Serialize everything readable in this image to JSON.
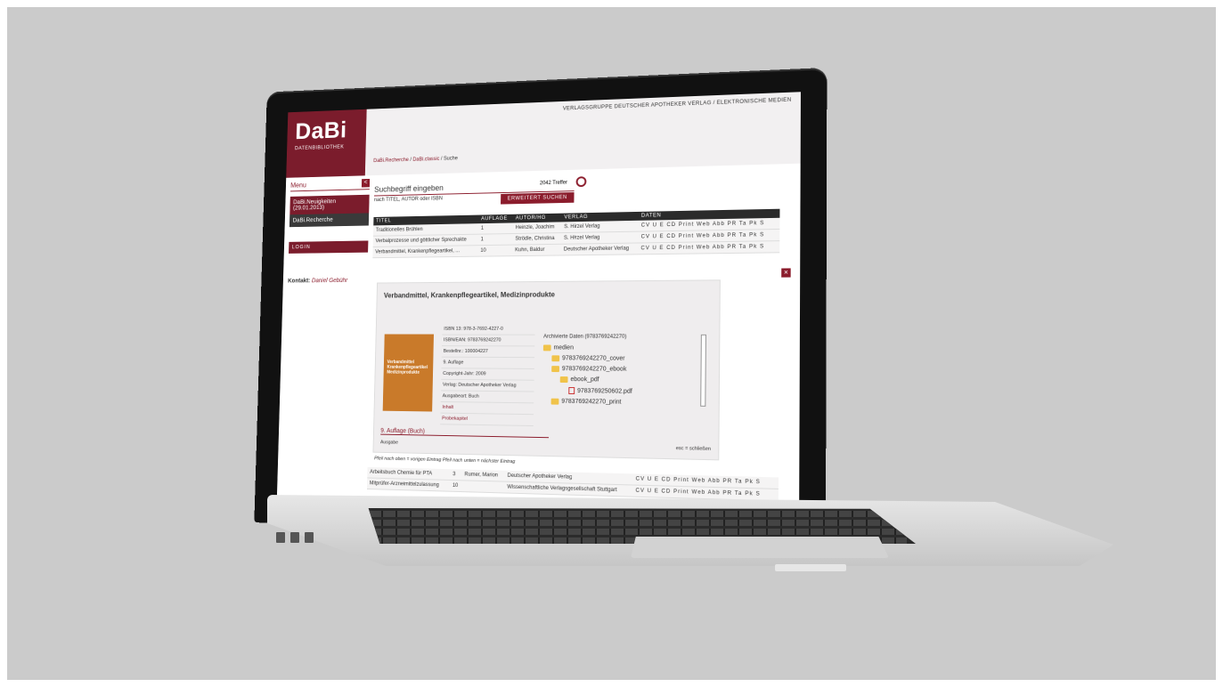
{
  "brand": {
    "logo": "DaBi",
    "subtitle": "DATENBIBLIOTHEK"
  },
  "header": {
    "publisher": "VERLAGSGRUPPE DEUTSCHER APOTHEKER VERLAG / ELEKTRONISCHE MEDIEN"
  },
  "breadcrumb": {
    "part1": "DaBi.Recherche",
    "part2": "DaBi.classic",
    "part3": "Suche"
  },
  "sidebar": {
    "menu_label": "Menu",
    "toggle": "<",
    "items": [
      {
        "label": "DaBi.Neuigkeiten (29.01.2013)"
      },
      {
        "label": "DaBi.Recherche"
      }
    ],
    "login": "LOGIN",
    "contact_prefix": "Kontakt:",
    "contact_name": "Daniel Gebühr"
  },
  "search": {
    "label": "Suchbegriff eingeben",
    "hint": "nach TITEL, AUTOR oder ISBN",
    "hits": "2042 Treffer",
    "advanced_button": "ERWEITERT SUCHEN"
  },
  "results": {
    "columns": [
      "TITEL",
      "AUFLAGE",
      "AUTOR/HG",
      "VERLAG",
      "DATEN"
    ],
    "rows": [
      {
        "title": "Traditionelles Brühlen",
        "edition": "1",
        "author": "Heinzle, Joachim",
        "publisher": "S. Hirzel Verlag",
        "data": "CV U E CD Print Web Abb PR Ta Pk S"
      },
      {
        "title": "Verbalprozesse und göttlicher Sprechakte",
        "edition": "1",
        "author": "Strödle, Christina",
        "publisher": "S. Hirzel Verlag",
        "data": "CV U E CD Print Web Abb PR Ta Pk S"
      },
      {
        "title": "Verbandmittel, Krankenpflegeartikel, ...",
        "edition": "10",
        "author": "Kuhn, Baldur",
        "publisher": "Deutscher Apotheker Verlag",
        "data": "CV U E CD Print Web Abb PR Ta Pk S"
      }
    ]
  },
  "detail": {
    "close": "×",
    "title": "Verbandmittel, Krankenpflegeartikel, Medizinprodukte",
    "cover_text": "Verbandmittel Krankenpflegeartikel Medizinprodukte",
    "meta": [
      "ISBN 13: 978-3-7692-4227-0",
      "ISBN/EAN: 9783769242270",
      "Bestellnr.: 100004227",
      "9. Auflage",
      "Copyright-Jahr: 2009",
      "Verlag: Deutscher Apotheker Verlag",
      "Ausgabeart: Buch"
    ],
    "pdf_links": [
      "Inhalt",
      "Probekapitel"
    ],
    "archive_header": "Archivierte Daten (9783769242270)",
    "folders": [
      {
        "label": "medien",
        "type": "folder"
      },
      {
        "label": "9783769242270_cover",
        "type": "folder"
      },
      {
        "label": "9783769242270_ebook",
        "type": "folder"
      },
      {
        "label": "ebook_pdf",
        "type": "folder"
      },
      {
        "label": "9783769250602.pdf",
        "type": "pdf"
      },
      {
        "label": "9783769242270_print",
        "type": "folder"
      }
    ],
    "edition_select": "9. Auflage (Buch)",
    "ausgabe": "Ausgabe",
    "esc": "esc = schließen"
  },
  "nav_hint": "Pfeil nach oben = vorigen Eintrag   Pfeil nach unten = nächster Eintrag",
  "results2": [
    {
      "title": "Arbeitsbuch Chemie für PTA",
      "edition": "3",
      "author": "Rumer, Marion",
      "publisher": "Deutscher Apotheker Verlag",
      "data": "CV U E CD Print Web Abb PR Ta Pk S"
    },
    {
      "title": "Mitprüfer-Arzneimittelzulassung",
      "edition": "10",
      "author": "",
      "publisher": "Wissenschaftliche Verlagsgesellschaft Stuttgart",
      "data": "CV U E CD Print Web Abb PR Ta Pk S"
    }
  ]
}
